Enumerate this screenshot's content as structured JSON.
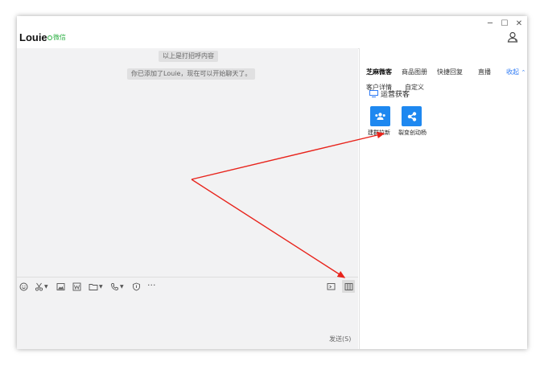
{
  "header": {
    "contact_name": "Louie",
    "platform_tag": "微信",
    "minimize_glyph": "─",
    "maximize_glyph": "☐",
    "close_glyph": "✕"
  },
  "chat": {
    "system_messages": [
      "以上是打招呼内容",
      "你已添加了Louie，现在可以开始聊天了。"
    ],
    "toolbar_icons": [
      "emoji-icon",
      "scissors-icon",
      "image-icon",
      "word-icon",
      "folder-icon",
      "phone-icon",
      "shield-icon",
      "more-icon",
      "screen-icon",
      "sidebar-icon"
    ],
    "more_glyph": "···",
    "send_label": "发送(S)"
  },
  "panel": {
    "tabs_row1": [
      "芝麻微客",
      "商品图册",
      "快捷回复",
      "直播"
    ],
    "collapse_label": "收起",
    "tabs_row2": [
      "客户详情",
      "自定义"
    ],
    "section_title": "运营获客",
    "tools": [
      "建群拉新",
      "裂变创动杨"
    ]
  },
  "colors": {
    "accent_blue": "#1e88f0",
    "link_blue": "#2f7bf5",
    "wechat_green": "#2eb045",
    "annotation_red": "#e8231b"
  }
}
